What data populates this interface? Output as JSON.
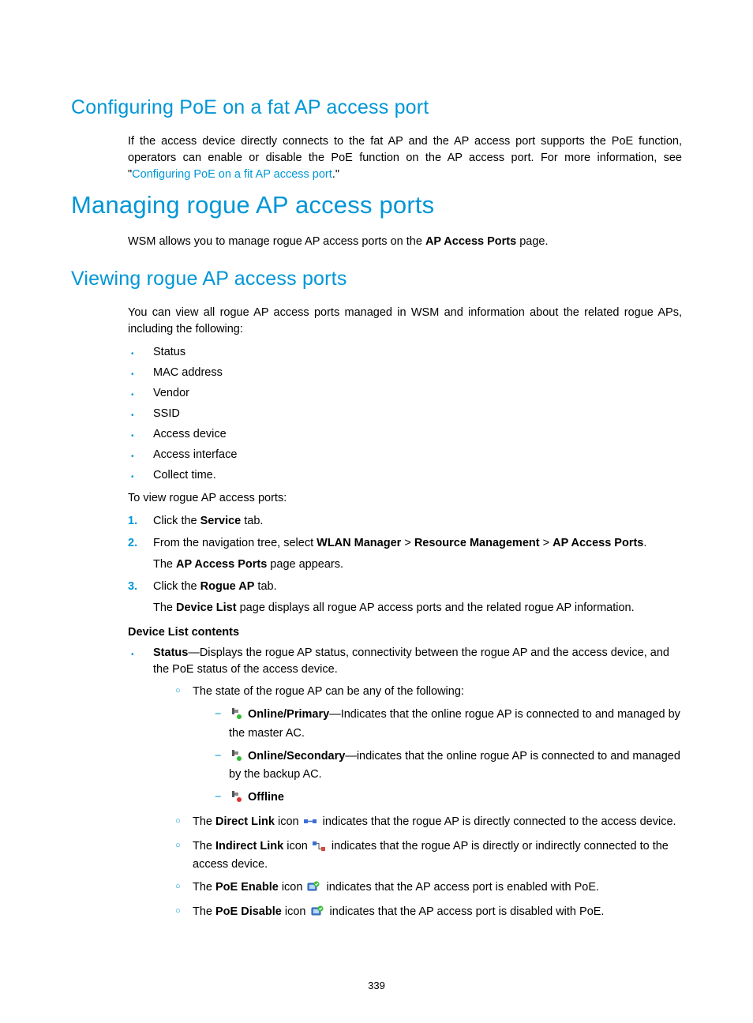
{
  "section1": {
    "title": "Configuring PoE on a fat AP access port",
    "para_part1": "If the access device directly connects to the fat AP and the AP access port supports the PoE function, operators can enable or disable the PoE function on the AP access port. For more information, see \"",
    "link": "Configuring PoE on a fit AP access port",
    "para_part2": ".\""
  },
  "section2": {
    "title": "Managing rogue AP access ports",
    "intro_pre": "WSM allows you to manage rogue AP access ports on the ",
    "intro_bold": "AP Access Ports",
    "intro_post": " page."
  },
  "section3": {
    "title": "Viewing rogue AP access ports",
    "intro": "You can view all rogue AP access ports managed in WSM and information about the related rogue APs, including the following:",
    "bullets": [
      "Status",
      "MAC address",
      "Vendor",
      "SSID",
      "Access device",
      "Access interface",
      "Collect time."
    ],
    "steps_intro": "To view rogue AP access ports:",
    "step1_pre": "Click the ",
    "step1_bold": "Service",
    "step1_post": " tab.",
    "step2_pre": "From the navigation tree, select ",
    "step2_b1": "WLAN Manager",
    "step2_sep": " > ",
    "step2_b2": "Resource Management",
    "step2_b3": "AP Access Ports",
    "step2_post": ".",
    "step2_sub_pre": "The ",
    "step2_sub_bold": "AP Access Ports",
    "step2_sub_post": " page appears.",
    "step3_pre": "Click the ",
    "step3_bold": "Rogue AP",
    "step3_post": " tab.",
    "step3_sub_pre": "The ",
    "step3_sub_bold": "Device List",
    "step3_sub_post": " page displays all rogue AP access ports and the related rogue AP information.",
    "subheading": "Device List contents",
    "status_bold": "Status",
    "status_desc": "—Displays the rogue AP status, connectivity between the rogue AP and the access device, and the PoE status of the access device.",
    "state_intro": "The state of the rogue AP can be any of the following:",
    "state1_bold": "Online/Primary",
    "state1_desc": "—Indicates that the online rogue AP is connected to and managed by the master AC.",
    "state2_bold": "Online/Secondary",
    "state2_desc": "—indicates that the online rogue AP is connected to and managed by the backup AC.",
    "state3_bold": "Offline",
    "direct_pre": "The ",
    "direct_bold": "Direct Link",
    "direct_mid": " icon ",
    "direct_post": " indicates that the rogue AP is directly connected to the access device.",
    "indirect_pre": "The ",
    "indirect_bold": "Indirect Link",
    "indirect_mid": " icon ",
    "indirect_post": " indicates that the rogue AP is directly or indirectly connected to the access device.",
    "poe_en_pre": "The ",
    "poe_en_bold": "PoE Enable",
    "poe_en_mid": " icon ",
    "poe_en_post": " indicates that the AP access port is enabled with PoE.",
    "poe_dis_pre": "The ",
    "poe_dis_bold": "PoE Disable",
    "poe_dis_mid": " icon ",
    "poe_dis_post": " indicates that the AP access port is disabled with PoE."
  },
  "page_number": "339"
}
